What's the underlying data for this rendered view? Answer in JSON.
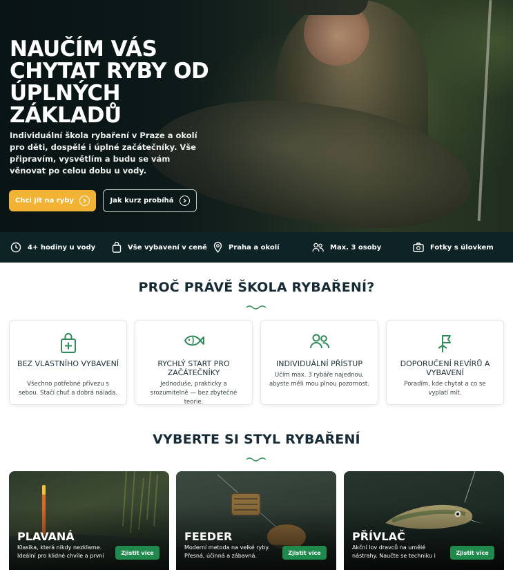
{
  "hero": {
    "title": "NAUČÍM VÁS CHYTAT RYBY OD ÚPLNÝCH ZÁKLADŮ",
    "text": "Individuální škola rybaření v Praze a okolí pro děti, dospělé i úplné začátečníky. Vše připravím, vysvětlím a budu se vám věnovat po celou dobu u vody.",
    "primary_button": "Chci jít na ryby",
    "secondary_button": "Jak kurz probíhá"
  },
  "features": [
    {
      "icon": "clock-icon",
      "label": "4+ hodiny u vody"
    },
    {
      "icon": "bag-icon",
      "label": "Vše vybavení v ceně"
    },
    {
      "icon": "location-pin-icon",
      "label": "Praha a okolí"
    },
    {
      "icon": "people-icon",
      "label": "Max. 3 osoby"
    },
    {
      "icon": "camera-icon",
      "label": "Fotky s úlovkem"
    }
  ],
  "why": {
    "title": "PROČ PRÁVĚ ŠKOLA RYBAŘENÍ?",
    "cards": [
      {
        "icon": "bag-plus-icon",
        "title": "BEZ VLASTNÍHO VYBAVENÍ",
        "text": "Všechno potřebné přivezu s sebou. Stačí chuť a dobrá nálada."
      },
      {
        "icon": "fish-icon",
        "title": "RYCHLÝ START PRO ZAČÁTEČNÍKY",
        "text": "Jednoduše, prakticky a srozumitelně — bez zbytečné teorie."
      },
      {
        "icon": "people-icon",
        "title": "INDIVIDUÁLNÍ PŘÍSTUP",
        "text": "Učím max. 3 rybáře najednou, abyste měli mou plnou pozornost."
      },
      {
        "icon": "map-flag-icon",
        "title": "DOPORUČENÍ REVÍRŮ A VYBAVENÍ",
        "text": "Poradím, kde chytat a co se vyplatí mít."
      }
    ]
  },
  "styles": {
    "title": "VYBERTE SI STYL RYBAŘENÍ",
    "cards": [
      {
        "title": "PLAVANÁ",
        "text": "Klasika, která nikdy nezklame. Ideální pro klidné chvíle a první úlovky.",
        "button": "Zjistit více"
      },
      {
        "title": "FEEDER",
        "text": "Moderní metoda na velké ryby. Přesná, účinná a zábavná.",
        "button": "Zjistit více"
      },
      {
        "title": "PŘÍVLAČ",
        "text": "Akční lov dravců na umělé nástrahy. Naučte se techniku i taktiku.",
        "button": "Zjistit více"
      }
    ]
  },
  "colors": {
    "accent_yellow": "#f2b233",
    "green": "#1f8a4c",
    "icon_green": "#2e8b57",
    "dark_bar": "#0e2326"
  }
}
